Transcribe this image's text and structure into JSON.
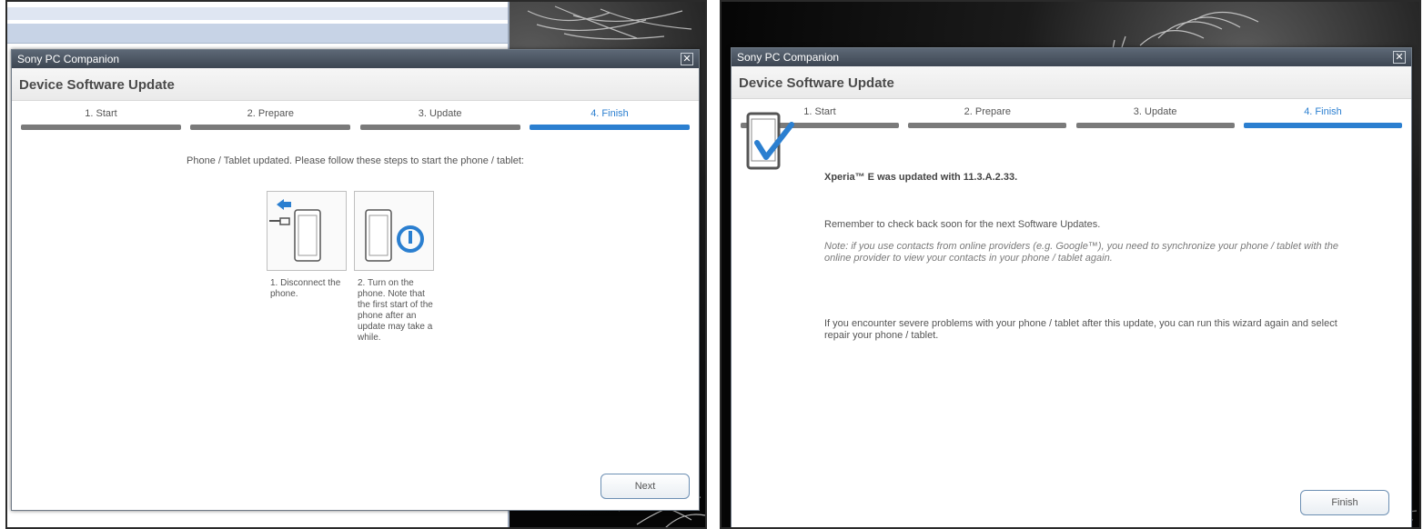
{
  "left": {
    "window_title": "Sony PC Companion",
    "close_glyph": "✕",
    "header_title": "Device Software Update",
    "steps": [
      {
        "label": "1. Start"
      },
      {
        "label": "2. Prepare"
      },
      {
        "label": "3. Update"
      },
      {
        "label": "4. Finish"
      }
    ],
    "active_step": 4,
    "instruction": "Phone / Tablet updated. Please follow these steps to start the phone / tablet:",
    "cards": [
      {
        "icon": "disconnect-phone-icon",
        "caption": "1. Disconnect the phone."
      },
      {
        "icon": "power-on-phone-icon",
        "caption": "2. Turn on the phone. Note that the first start of the phone after an update may take a while."
      }
    ],
    "next_label": "Next"
  },
  "right": {
    "window_title": "Sony PC Companion",
    "close_glyph": "✕",
    "header_title": "Device Software Update",
    "steps": [
      {
        "label": "1. Start"
      },
      {
        "label": "2. Prepare"
      },
      {
        "label": "3. Update"
      },
      {
        "label": "4. Finish"
      }
    ],
    "active_step": 4,
    "status_icon": "tablet-checkmark-icon",
    "updated_message": "Xperia™ E was updated with 11.3.A.2.33.",
    "reminder": "Remember to check back soon for the next Software Updates.",
    "note": "Note: if you use contacts from online providers (e.g. Google™), you need to synchronize your phone / tablet with the online provider to view your contacts in your phone / tablet again.",
    "problems": "If you encounter severe problems with your phone / tablet after this update, you can run this wizard again and select repair your phone / tablet.",
    "finish_label": "Finish"
  },
  "colors": {
    "accent": "#2b7fd0",
    "inactive_bar": "#7a7a7a",
    "title_bar": "#4a5360"
  }
}
